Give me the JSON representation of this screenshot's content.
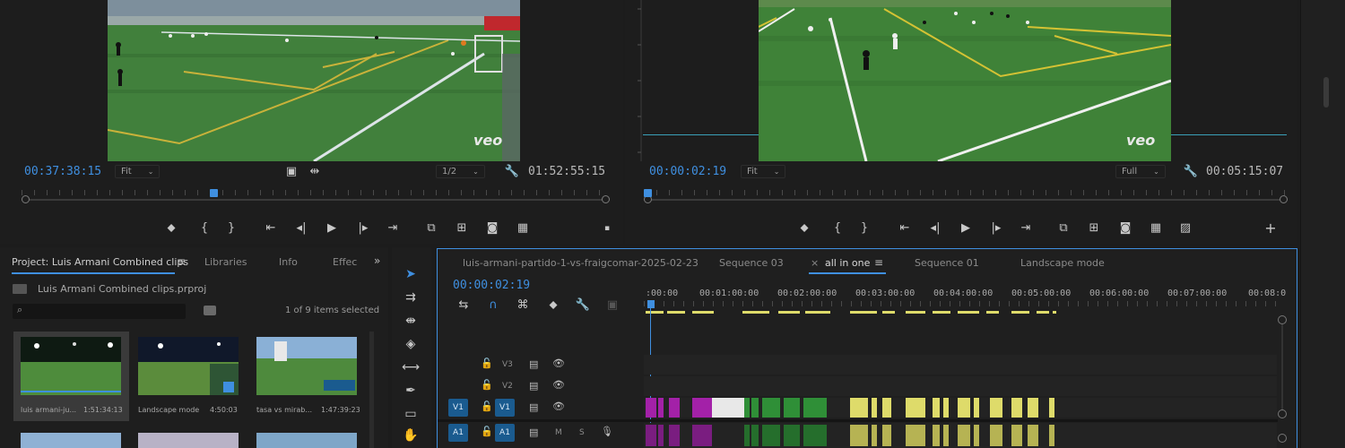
{
  "source_monitor": {
    "timecode_in": "00:37:38:15",
    "zoom": "Fit",
    "resolution": "1/2",
    "duration": "01:52:55:15",
    "watermark": "veo"
  },
  "program_monitor": {
    "timecode_in": "00:00:02:19",
    "zoom": "Fit",
    "resolution": "Full",
    "duration": "00:05:15:07",
    "watermark": "veo"
  },
  "project_panel": {
    "tabs": [
      "Project: Luis Armani Combined clips",
      "Libraries",
      "Info",
      "Effec"
    ],
    "file_name": "Luis Armani Combined clips.prproj",
    "items_selected": "1 of 9 items selected",
    "clips": [
      {
        "name": "luis armani-ju...",
        "duration": "1:51:34:13"
      },
      {
        "name": "Landscape mode",
        "duration": "4:50:03"
      },
      {
        "name": "tasa vs mirab...",
        "duration": "1:47:39:23"
      }
    ]
  },
  "timeline": {
    "tabs": [
      "luis-armani-partido-1-vs-fraigcomar-2025-02-23",
      "Sequence 03",
      "all in one",
      "Sequence 01",
      "Landscape mode"
    ],
    "active_tab": "all in one",
    "timecode": "00:00:02:19",
    "ruler_labels": [
      ":00:00",
      "00:01:00:00",
      "00:02:00:00",
      "00:03:00:00",
      "00:04:00:00",
      "00:05:00:00",
      "00:06:00:00",
      "00:07:00:00",
      "00:08:0"
    ],
    "tracks": [
      {
        "label": "V3",
        "src": ""
      },
      {
        "label": "V2",
        "src": ""
      },
      {
        "label": "V1",
        "src": "V1"
      },
      {
        "label": "A1",
        "src": "A1"
      }
    ],
    "audio_letters": {
      "mute": "M",
      "solo": "S"
    }
  },
  "colors": {
    "accent_blue": "#3f8fe0",
    "clip_magenta": "#a321a8",
    "clip_green": "#2f8f37",
    "clip_yellow": "#dedb6a",
    "clip_white": "#e8e8e8"
  }
}
